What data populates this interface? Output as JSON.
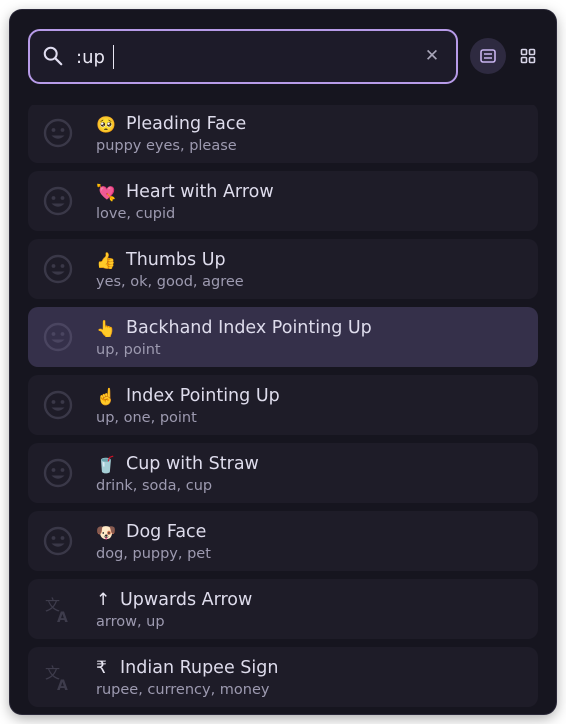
{
  "search": {
    "value": ":up"
  },
  "icons": {
    "search": "search-icon",
    "clear": "close-icon",
    "list_view": "list-view-icon",
    "grid_view": "grid-view-icon",
    "emoji": "smiley-icon",
    "symbol": "translate-icon"
  },
  "colors": {
    "accent": "#b79be8",
    "background": "#16151f",
    "item": "#1e1c28",
    "selected": "#35304a"
  },
  "items": [
    {
      "glyph": "🥺",
      "title": "Pleading Face",
      "keywords": "puppy eyes, please",
      "kind": "emoji"
    },
    {
      "glyph": "💘",
      "title": "Heart with Arrow",
      "keywords": "love, cupid",
      "kind": "emoji"
    },
    {
      "glyph": "👍",
      "title": "Thumbs Up",
      "keywords": "yes, ok, good, agree",
      "kind": "emoji"
    },
    {
      "glyph": "👆",
      "title": "Backhand Index Pointing Up",
      "keywords": "up, point",
      "kind": "emoji",
      "selected": true
    },
    {
      "glyph": "☝️",
      "title": "Index Pointing Up",
      "keywords": "up, one, point",
      "kind": "emoji"
    },
    {
      "glyph": "🥤",
      "title": "Cup with Straw",
      "keywords": "drink, soda, cup",
      "kind": "emoji"
    },
    {
      "glyph": "🐶",
      "title": "Dog Face",
      "keywords": "dog, puppy, pet",
      "kind": "emoji"
    },
    {
      "glyph": "↑",
      "title": "Upwards Arrow",
      "keywords": "arrow, up",
      "kind": "symbol"
    },
    {
      "glyph": "₹",
      "title": "Indian Rupee Sign",
      "keywords": "rupee, currency, money",
      "kind": "symbol"
    }
  ]
}
